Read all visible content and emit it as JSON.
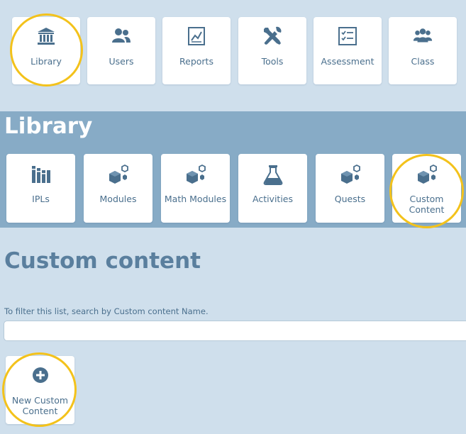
{
  "nav": {
    "items": [
      {
        "label": "Library",
        "icon": "library-icon"
      },
      {
        "label": "Users",
        "icon": "users-icon"
      },
      {
        "label": "Reports",
        "icon": "reports-icon"
      },
      {
        "label": "Tools",
        "icon": "tools-icon"
      },
      {
        "label": "Assessment",
        "icon": "assessment-icon"
      },
      {
        "label": "Class",
        "icon": "class-icon"
      }
    ]
  },
  "library": {
    "title": "Library",
    "items": [
      {
        "label": "IPLs",
        "icon": "books-icon"
      },
      {
        "label": "Modules",
        "icon": "cubes-icon"
      },
      {
        "label": "Math Modules",
        "icon": "cubes-icon"
      },
      {
        "label": "Activities",
        "icon": "flask-icon"
      },
      {
        "label": "Quests",
        "icon": "cubes-icon"
      },
      {
        "label": "Custom Content",
        "icon": "cubes-icon"
      }
    ]
  },
  "main": {
    "title": "Custom content",
    "filter_hint": "To filter this list, search by Custom content Name.",
    "search_value": "",
    "new_button_label": "New Custom Content"
  },
  "colors": {
    "background": "#cfdfec",
    "band": "#87abc6",
    "icon": "#4a6f8d",
    "highlight": "#f3c21b"
  }
}
